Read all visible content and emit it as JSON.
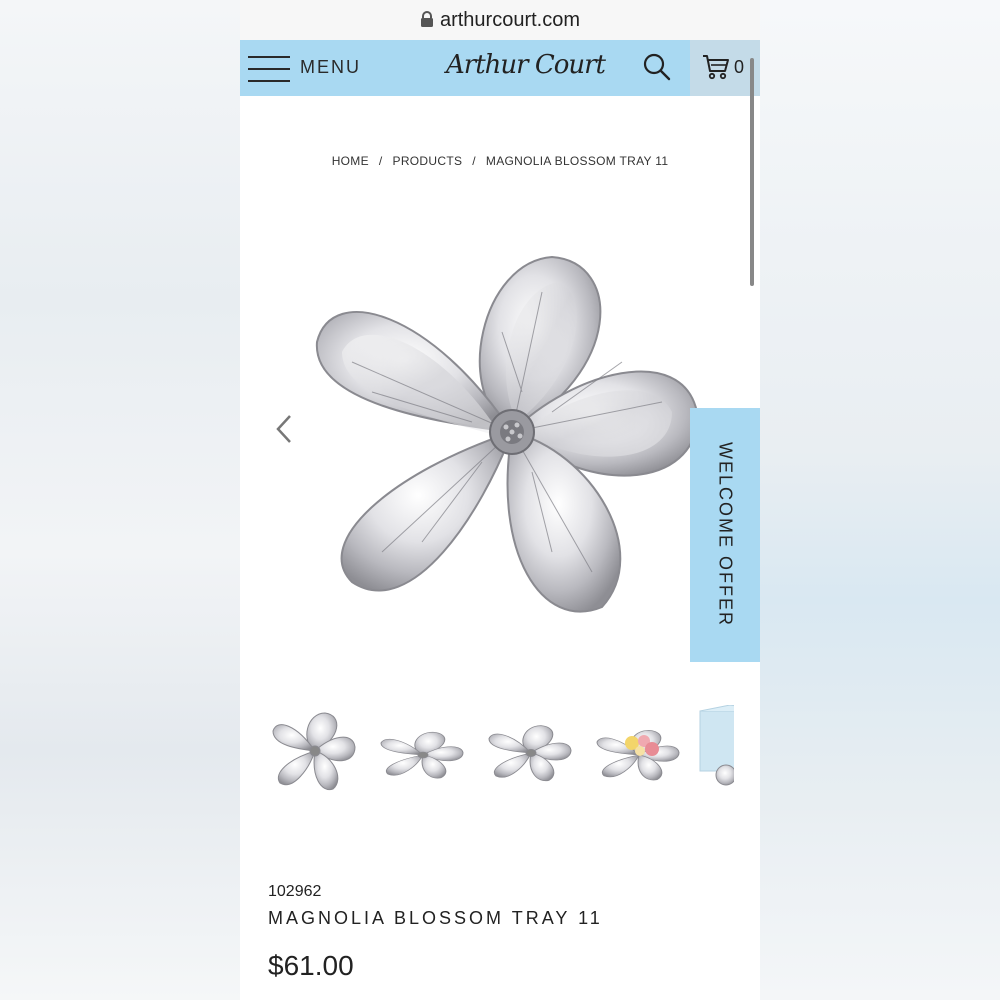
{
  "browser": {
    "url": "arthurcourt.com"
  },
  "header": {
    "menu_label": "MENU",
    "logo_text": "Arthur Court",
    "cart_count": "0",
    "accent_color": "#a9d9f2"
  },
  "breadcrumb": {
    "items": [
      "HOME",
      "PRODUCTS",
      "MAGNOLIA BLOSSOM TRAY 11"
    ],
    "separator": "/"
  },
  "gallery": {
    "main_image": "magnolia-blossom-tray-silver",
    "thumbnails": [
      "magnolia-tray-top",
      "magnolia-tray-angle",
      "magnolia-tray-side",
      "magnolia-tray-with-candy",
      "magnolia-tray-gift-box"
    ]
  },
  "welcome_tab": {
    "label": "WELCOME OFFER"
  },
  "product": {
    "sku": "102962",
    "name": "MAGNOLIA BLOSSOM TRAY 11",
    "price": "$61.00"
  }
}
